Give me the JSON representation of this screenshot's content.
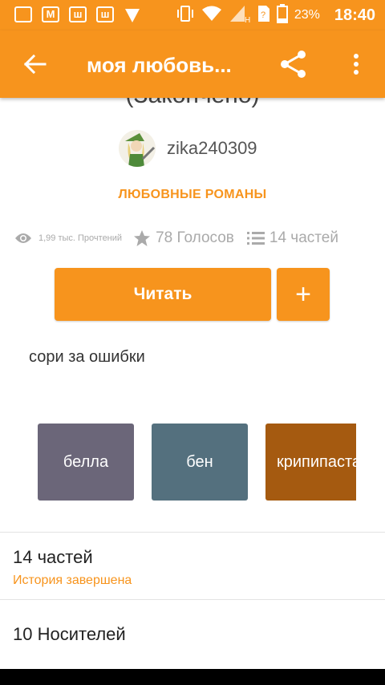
{
  "statusbar": {
    "icons": [
      "image-icon",
      "gmail-icon",
      "w-app-icon",
      "w-app-icon",
      "vpn-icon"
    ],
    "battery_percent": "23%",
    "time": "18:40",
    "network_label": "H"
  },
  "appbar": {
    "title": "моя любовь..."
  },
  "story": {
    "partial_title": "(Закончено)",
    "author": "zika240309",
    "genre": "ЛЮБОВНЫЕ РОМАНЫ",
    "reads": "1,99 тыс. Прочтений",
    "votes": "78 Голосов",
    "parts": "14 частей",
    "read_label": "Читать",
    "add_label": "+",
    "description": "сори за ошибки"
  },
  "tags": [
    {
      "label": "белла",
      "color": "#6b6679"
    },
    {
      "label": "бен",
      "color": "#54707e"
    },
    {
      "label": "крипипаста",
      "color": "#a55a10"
    }
  ],
  "details": {
    "parts_count": "14 частей",
    "parts_status": "История завершена",
    "carriers": "10 Носителей"
  },
  "colors": {
    "accent": "#f7941d",
    "muted": "#aaaaaa"
  }
}
